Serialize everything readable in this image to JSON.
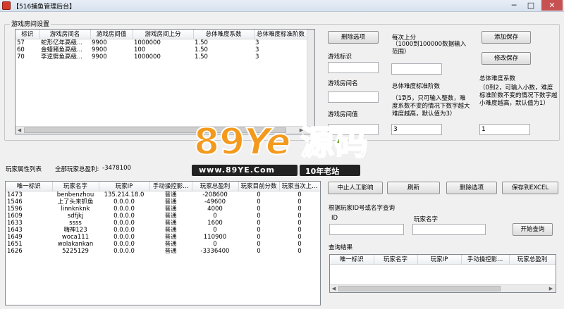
{
  "window": {
    "title": "【516捕鱼管理后台】",
    "minimize": "─",
    "maximize": "□",
    "close": "✕"
  },
  "room_settings": {
    "group_label": "游戏房间设置",
    "columns": [
      "标识",
      "游戏房间名",
      "游戏房间值",
      "游戏房间上分",
      "总体难度系数",
      "总体难度标准阶数"
    ],
    "rows": [
      [
        "57",
        "蛇形亿年高级...",
        "9900",
        "1000000",
        "1.50",
        "3"
      ],
      [
        "60",
        "金蜡猪鱼高级...",
        "9900",
        "100",
        "1.50",
        "3"
      ],
      [
        "70",
        "李逵劈鱼高级...",
        "9900",
        "1000000",
        "1.50",
        "3"
      ]
    ],
    "delete_btn": "删除选项",
    "label_room_id": "游戏标识",
    "label_room_name": "游戏房间名",
    "label_room_value": "游戏房间值",
    "label_upper": "每次上分",
    "hint_upper": "（1000到100000数据输入范围）",
    "label_std": "总体难度标准阶数",
    "hint_std": "（1到5，只可输入整数，难度系数不变的情况下数字越大难度越高，默认值为3）",
    "std_value": "3",
    "add_save_btn": "添加保存",
    "modify_save_btn": "修改保存",
    "label_coef": "总体难度系数",
    "hint_coef": "（0到2，可输入小数，难度标准阶数不变的情况下数字越小难度越高，默认值为1）",
    "coef_value": "1"
  },
  "player_list": {
    "label": "玩家属性列表",
    "total_profit_label": "全部玩家总盈利:",
    "total_profit_value": "-3478100",
    "columns": [
      "唯一标识",
      "玩家名字",
      "玩家IP",
      "手动操控影...",
      "玩家总盈利",
      "玩家目前分数",
      "玩家当次上..."
    ],
    "rows": [
      [
        "1473",
        "benbenzhou",
        "135.214.18.0",
        "普通",
        "-208600",
        "0",
        "0"
      ],
      [
        "1546",
        "上了头来抓鱼",
        "0.0.0.0",
        "普通",
        "-49600",
        "0",
        "0"
      ],
      [
        "1596",
        "linnknknk",
        "0.0.0.0",
        "普通",
        "4000",
        "0",
        "0"
      ],
      [
        "1609",
        "sdfjkj",
        "0.0.0.0",
        "普通",
        "0",
        "0",
        "0"
      ],
      [
        "1633",
        "ssss",
        "0.0.0.0",
        "普通",
        "1600",
        "0",
        "0"
      ],
      [
        "1643",
        "嗨神123",
        "0.0.0.0",
        "普通",
        "0",
        "0",
        "0"
      ],
      [
        "1649",
        "woca111",
        "0.0.0.0",
        "普通",
        "110900",
        "0",
        "0"
      ],
      [
        "1651",
        "wolakankan",
        "0.0.0.0",
        "普通",
        "0",
        "0",
        "0"
      ],
      [
        "1626",
        "5225129",
        "0.0.0.0",
        "普通",
        "-3336400",
        "0",
        "0"
      ]
    ]
  },
  "actions": {
    "stop_manual": "中止人工影响",
    "refresh": "刷新",
    "delete": "删除选项",
    "save_excel": "保存到EXCEL"
  },
  "query": {
    "title": "根据玩家ID号或名字查询",
    "label_id": "ID",
    "label_name": "玩家名字",
    "start_btn": "开始查询",
    "result_label": "查询结果",
    "result_columns": [
      "唯一标识",
      "玩家名字",
      "玩家IP",
      "手动操控影...",
      "玩家总盈利"
    ]
  },
  "watermark": {
    "logo_89": "89",
    "logo_ye": "Ye",
    "logo_cn": "源码",
    "url": "www.89YE.Com",
    "slogan": "10年老站"
  },
  "colors": {
    "watermark_orange": "#f39a1e",
    "watermark_green": "#5fa52c",
    "titlebar": "#dce6f2",
    "close_red": "#c75050"
  }
}
